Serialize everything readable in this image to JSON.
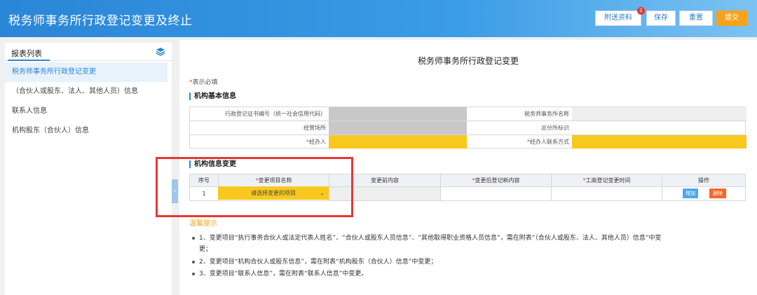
{
  "header": {
    "title": "税务师事务所行政登记变更及终止",
    "buttons": {
      "attach": "附送资料",
      "attach_badge": "2",
      "save": "保存",
      "reset": "重置",
      "submit": "提交"
    }
  },
  "sidebar": {
    "title": "报表列表",
    "items": [
      {
        "label": "税务师事务所行政登记变更"
      },
      {
        "label": "（合伙人或股东、法人、其他人员）信息"
      },
      {
        "label": "联系人信息"
      },
      {
        "label": "机构股东（合伙人）信息"
      }
    ]
  },
  "form": {
    "title": "税务师事务所行政登记变更",
    "required_note": "表示必填",
    "required_mark": "*",
    "basic_section": "机构基本信息",
    "basic_labels": {
      "cert_no": "行政登记证书编号（统一社会信用代码）",
      "firm_name": "税务师事务所名称",
      "address": "经营场所",
      "branch": "总分所标识",
      "handler": "经办人",
      "handler_contact": "经办人联系方式"
    },
    "change_section": "机构信息变更",
    "change_headers": {
      "seq": "序号",
      "item_name": "变更项目名称",
      "before": "变更前内容",
      "after": "变更后登记新内容",
      "time": "工商登记变更时间",
      "ops": "操作"
    },
    "row": {
      "seq": "1",
      "select_placeholder": "请选择变更的项目",
      "add": "增加",
      "delete": "删除"
    }
  },
  "tips": {
    "title": "温馨提示",
    "items": [
      {
        "line1": "1、变更项目“执行事务合伙人或法定代表人姓名”、“合伙人或股东人员信息”、“其他取得职业资格人员信息”，需在附表“（合伙人或股东、法人、其他人员）信息”中变",
        "line2": "更；"
      },
      {
        "line1": "2、变更项目“机构合伙人或股东信息”，需在附表“机构股东（合伙人）信息”中变更；"
      },
      {
        "line1": "3、变更项目“联系人信息”，需在附表“联系人信息”中变更。"
      }
    ]
  },
  "colors": {
    "primary": "#2a86d6",
    "accent": "#f6a21a",
    "required": "#e53935",
    "highlight": "#e53935",
    "yellow_field": "#f7c91e",
    "add_button": "#4ea8e8",
    "delete_button": "#f26a2b"
  },
  "icons": [
    "layers-icon",
    "collapse-arrow-icon",
    "chevron-down-icon"
  ]
}
